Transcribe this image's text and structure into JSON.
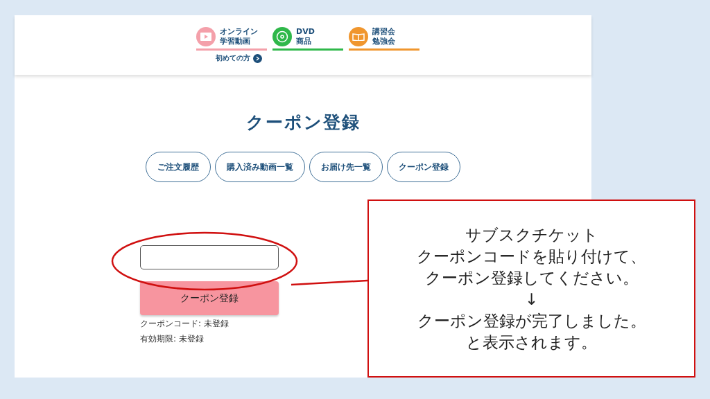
{
  "nav": {
    "items": [
      {
        "kind": "video",
        "lines": [
          "オンライン",
          "学習動画"
        ],
        "color": "#f4a0aa"
      },
      {
        "kind": "dvd",
        "lines": [
          "DVD",
          "商品"
        ],
        "color": "#2fb84a"
      },
      {
        "kind": "seminar",
        "lines": [
          "講習会",
          "勉強会"
        ],
        "color": "#f0962e"
      }
    ],
    "first_time_link": "初めての方"
  },
  "title": "クーポン登録",
  "tabs": [
    "ご注文履歴",
    "購入済み動画一覧",
    "お届け先一覧",
    "クーポン登録"
  ],
  "form": {
    "button": "クーポン登録",
    "status_lines": [
      "クーポンコード: 未登録",
      "有効期限: 未登録"
    ]
  },
  "callout": {
    "lines": [
      "サブスクチケット",
      "クーポンコードを貼り付けて、",
      "クーポン登録してください。",
      "↓",
      "クーポン登録が完了しました。",
      "と表示されます。"
    ]
  }
}
